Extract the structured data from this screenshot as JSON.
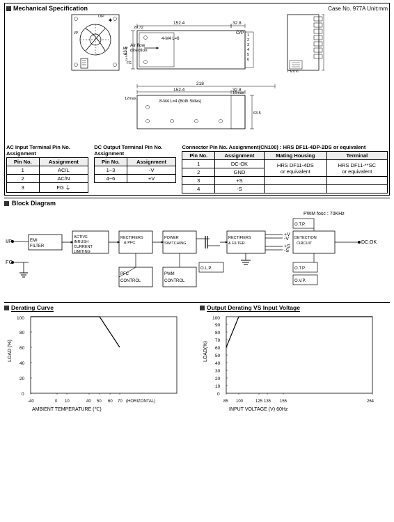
{
  "page": {
    "title": "Mechanical Specification",
    "case_info": "Case No. 977A    Unit:mm",
    "block_diagram_title": "Block Diagram",
    "derating_title": "Derating Curve",
    "output_derating_title": "Output Derating VS Input Voltage",
    "pwm_freq": "PWM fosc : 70KHz"
  },
  "ac_table": {
    "title": "AC Input Terminal Pin No. Assignment",
    "headers": [
      "Pin No.",
      "Assignment"
    ],
    "rows": [
      [
        "1",
        "AC/L"
      ],
      [
        "2",
        "AC/N"
      ],
      [
        "3",
        "FG ⏚"
      ]
    ]
  },
  "dc_table": {
    "title": "DC Output Terminal Pin No. Assignment",
    "headers": [
      "Pin No.",
      "Assignment"
    ],
    "rows": [
      [
        "1~3",
        "-V"
      ],
      [
        "4~6",
        "+V"
      ]
    ]
  },
  "connector_table": {
    "title": "Connector Pin No. Assignment(CN100) : HRS DF11-4DP-2DS or equivalent",
    "headers": [
      "Pin No.",
      "Assignment",
      "Mating Housing",
      "Terminal"
    ],
    "rows": [
      [
        "1",
        "DC-OK",
        "",
        ""
      ],
      [
        "2",
        "GND",
        "HRS DF11-4DS",
        "HRS DF11-**SC"
      ],
      [
        "3",
        "+S",
        "or equivalent",
        "or equivalent"
      ],
      [
        "4",
        "-S",
        "",
        ""
      ]
    ]
  },
  "block_diagram": {
    "components": [
      "EMI FILTER",
      "ACTIVE INRUSH CURRENT LIMITING",
      "RECTIFIERS & PFC",
      "POWER SWITCHING",
      "RECTIFIERS & FILTER",
      "DETECTION CIRCUIT",
      "O.T.P.",
      "O.L.P.",
      "O.V.P.",
      "PFC CONTROL",
      "PWM CONTROL"
    ],
    "inputs": [
      "I/P",
      "FG"
    ],
    "outputs": [
      "+V",
      "-V",
      "+S",
      "-S",
      "DC:OK"
    ]
  },
  "derating_curve": {
    "x_label": "AMBIENT TEMPERATURE (℃)",
    "y_label": "LOAD (%)",
    "x_ticks": [
      "-40",
      "0",
      "10",
      "40",
      "50",
      "60",
      "70"
    ],
    "x_axis_label": "(HORIZONTAL)",
    "y_ticks": [
      "0",
      "20",
      "40",
      "60",
      "80",
      "100"
    ],
    "data_points": [
      {
        "x": -40,
        "y": 100
      },
      {
        "x": 50,
        "y": 100
      },
      {
        "x": 70,
        "y": 60
      }
    ]
  },
  "output_derating": {
    "x_label": "INPUT VOLTAGE (V) 60Hz",
    "y_label": "LOAD(%)",
    "x_ticks": [
      "85",
      "100",
      "125",
      "135",
      "155",
      "264"
    ],
    "y_ticks": [
      "0",
      "10",
      "20",
      "30",
      "40",
      "50",
      "60",
      "70",
      "80",
      "90",
      "100"
    ],
    "data_points": [
      {
        "x": 85,
        "y": 60
      },
      {
        "x": 100,
        "y": 100
      },
      {
        "x": 264,
        "y": 100
      }
    ]
  }
}
